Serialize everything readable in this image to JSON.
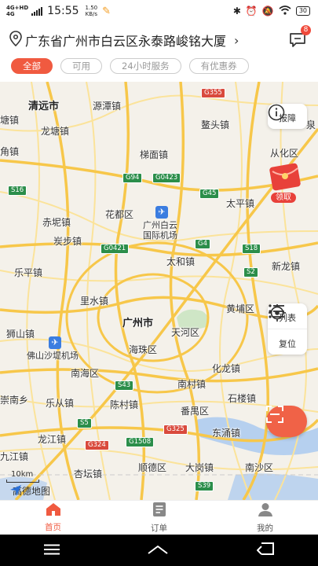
{
  "status": {
    "network_top": "4G+HD",
    "network_bottom": "4G",
    "time": "15:55",
    "speed_value": "1.50",
    "speed_unit": "KB/s",
    "battery": "30"
  },
  "location": {
    "address": "广东省广州市白云区永泰路峻铭大厦",
    "message_count": "8"
  },
  "filters": [
    "全部",
    "可用",
    "24小时服务",
    "有优惠券"
  ],
  "map": {
    "places": [
      {
        "name": "清远市",
        "big": true
      },
      {
        "name": "源潭镇"
      },
      {
        "name": "塘镇"
      },
      {
        "name": "龙塘镇"
      },
      {
        "name": "角镇"
      },
      {
        "name": "鳌头镇"
      },
      {
        "name": "梯面镇"
      },
      {
        "name": "从化区"
      },
      {
        "name": "泉"
      },
      {
        "name": "赤坭镇"
      },
      {
        "name": "花都区"
      },
      {
        "name": "太平镇"
      },
      {
        "name": "炭步镇"
      },
      {
        "name": "乐平镇"
      },
      {
        "name": "太和镇"
      },
      {
        "name": "新龙镇"
      },
      {
        "name": "里水镇"
      },
      {
        "name": "黄埔区"
      },
      {
        "name": "广州市",
        "big": true
      },
      {
        "name": "天河区"
      },
      {
        "name": "狮山镇"
      },
      {
        "name": "海珠区"
      },
      {
        "name": "南海区"
      },
      {
        "name": "化龙镇"
      },
      {
        "name": "南村镇"
      },
      {
        "name": "石楼镇"
      },
      {
        "name": "崇南乡"
      },
      {
        "name": "乐从镇"
      },
      {
        "name": "陈村镇"
      },
      {
        "name": "番禺区"
      },
      {
        "name": "龙江镇"
      },
      {
        "name": "东涌镇"
      },
      {
        "name": "九江镇"
      },
      {
        "name": "杏坛镇"
      },
      {
        "name": "顺德区"
      },
      {
        "name": "大岗镇"
      },
      {
        "name": "南沙区"
      }
    ],
    "airports": [
      {
        "line1": "广州白云",
        "line2": "国际机场"
      },
      {
        "line1": "佛山沙堤机场",
        "line2": ""
      }
    ],
    "road_shields": [
      "G355",
      "G94",
      "G0423",
      "S16",
      "G45",
      "G0421",
      "G4",
      "S18",
      "S2",
      "S43",
      "S5",
      "G325",
      "G1508",
      "G324",
      "S39"
    ],
    "scale_label": "10km",
    "logo_text": "高德地图",
    "report_label": "报障",
    "coupon_label": "领取",
    "list_label": "列表",
    "locate_label": "复位"
  },
  "tabs": [
    {
      "label": "首页",
      "icon": "home-icon"
    },
    {
      "label": "订单",
      "icon": "order-icon"
    },
    {
      "label": "我的",
      "icon": "profile-icon"
    }
  ],
  "colors": {
    "accent": "#f05a40",
    "road_major": "#f7c74a",
    "road_minor": "#fbe39a",
    "water": "#a6c8f0",
    "map_bg": "#f4f1ea"
  }
}
